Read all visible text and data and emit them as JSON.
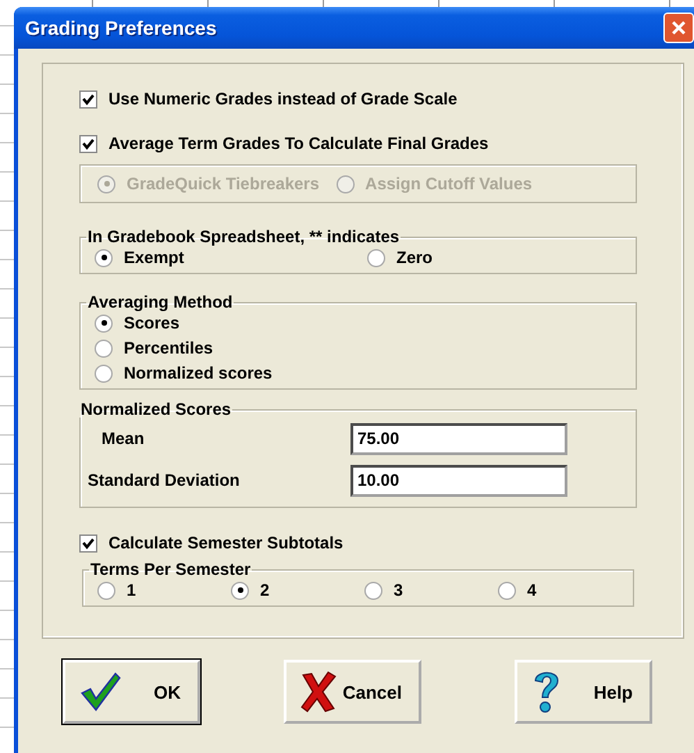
{
  "window": {
    "title": "Grading Preferences"
  },
  "options": [
    {
      "label": "Use Numeric Grades instead of Grade Scale",
      "checked": true
    },
    {
      "label": "Average Term Grades To Calculate Final Grades",
      "checked": true
    }
  ],
  "tiebreak": {
    "disabled": true,
    "choices": [
      {
        "label": "GradeQuick Tiebreakers",
        "selected": true
      },
      {
        "label": "Assign Cutoff Values",
        "selected": false
      }
    ]
  },
  "exempt_group": {
    "title": "In Gradebook Spreadsheet, ** indicates",
    "choices": [
      {
        "label": "Exempt",
        "selected": true
      },
      {
        "label": "Zero",
        "selected": false
      }
    ]
  },
  "averaging": {
    "title": "Averaging Method",
    "choices": [
      {
        "label": "Scores",
        "selected": true
      },
      {
        "label": "Percentiles",
        "selected": false
      },
      {
        "label": "Normalized scores",
        "selected": false
      }
    ]
  },
  "normalized": {
    "title": "Normalized Scores",
    "fields": [
      {
        "label": "Mean",
        "value": "75.00"
      },
      {
        "label": "Standard Deviation",
        "value": "10.00"
      }
    ]
  },
  "subtotals": {
    "label": "Calculate Semester Subtotals",
    "checked": true
  },
  "terms": {
    "title": "Terms Per Semester",
    "choices": [
      {
        "label": "1",
        "selected": false
      },
      {
        "label": "2",
        "selected": true
      },
      {
        "label": "3",
        "selected": false
      },
      {
        "label": "4",
        "selected": false
      }
    ]
  },
  "buttons": [
    {
      "kind": "ok",
      "label": "OK"
    },
    {
      "kind": "cancel",
      "label": "Cancel"
    },
    {
      "kind": "help",
      "label": "Help"
    }
  ]
}
